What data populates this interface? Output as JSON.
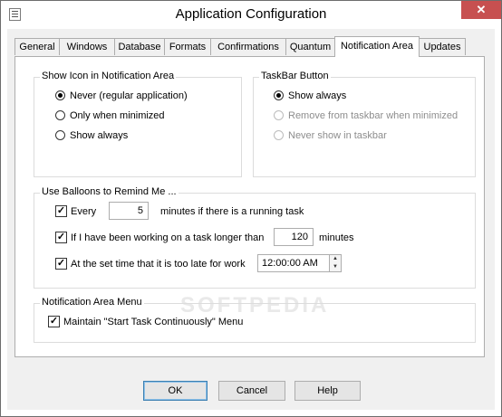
{
  "window": {
    "title": "Application Configuration",
    "close_glyph": "✕",
    "app_icon": "settings-list-icon"
  },
  "tabs": [
    {
      "label": "General"
    },
    {
      "label": "Windows"
    },
    {
      "label": "Database"
    },
    {
      "label": "Formats"
    },
    {
      "label": "Confirmations"
    },
    {
      "label": "Quantum"
    },
    {
      "label": "Notification Area",
      "active": true
    },
    {
      "label": "Updates"
    }
  ],
  "show_icon": {
    "title": "Show Icon in  Notification Area",
    "options": [
      {
        "label": "Never (regular application)",
        "selected": true
      },
      {
        "label": "Only when minimized",
        "selected": false
      },
      {
        "label": "Show always",
        "selected": false
      }
    ]
  },
  "taskbar": {
    "title": "TaskBar Button",
    "options": [
      {
        "label": "Show always",
        "selected": true,
        "enabled": true
      },
      {
        "label": "Remove from taskbar when minimized",
        "selected": false,
        "enabled": false
      },
      {
        "label": "Never show in taskbar",
        "selected": false,
        "enabled": false
      }
    ]
  },
  "balloons": {
    "title": "Use Balloons to Remind Me ...",
    "check_glyph": "✓",
    "every": {
      "label": "Every",
      "checked": true,
      "value": "5",
      "suffix": "minutes if there is a running task"
    },
    "working": {
      "label": "If I have been working on a task longer than",
      "checked": true,
      "value": "120",
      "suffix": "minutes"
    },
    "late": {
      "label": "At the set time that it is too late for work",
      "checked": true,
      "time": "12:00:00 AM"
    }
  },
  "menu": {
    "title": "Notification Area Menu",
    "maintain": {
      "label": "Maintain \"Start Task Continuously\" Menu",
      "checked": true
    }
  },
  "watermark": "SOFTPEDIA",
  "buttons": {
    "ok": "OK",
    "cancel": "Cancel",
    "help": "Help"
  }
}
